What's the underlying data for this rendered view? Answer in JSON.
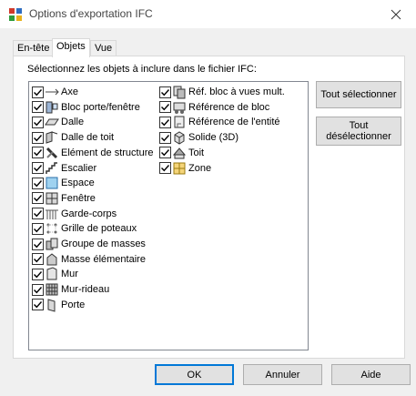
{
  "window": {
    "title": "Options d'exportation IFC",
    "icon": "app-ifc-icon",
    "close_icon": "close-icon"
  },
  "tabs": [
    {
      "label": "En-tête",
      "active": false
    },
    {
      "label": "Objets",
      "active": true
    },
    {
      "label": "Vue",
      "active": false
    }
  ],
  "instruction": "Sélectionnez les objets à inclure dans le fichier IFC:",
  "objects_col1": [
    {
      "label": "Axe",
      "checked": true,
      "icon": "axis-icon"
    },
    {
      "label": "Bloc porte/fenêtre",
      "checked": true,
      "icon": "door-window-block-icon"
    },
    {
      "label": "Dalle",
      "checked": true,
      "icon": "slab-icon"
    },
    {
      "label": "Dalle de toit",
      "checked": true,
      "icon": "roof-slab-icon"
    },
    {
      "label": "Elément de structure",
      "checked": true,
      "icon": "structural-member-icon"
    },
    {
      "label": "Escalier",
      "checked": true,
      "icon": "stair-icon"
    },
    {
      "label": "Espace",
      "checked": true,
      "icon": "space-icon"
    },
    {
      "label": "Fenêtre",
      "checked": true,
      "icon": "window-icon"
    },
    {
      "label": "Garde-corps",
      "checked": true,
      "icon": "railing-icon"
    },
    {
      "label": "Grille de poteaux",
      "checked": true,
      "icon": "column-grid-icon"
    },
    {
      "label": "Groupe de masses",
      "checked": true,
      "icon": "mass-group-icon"
    },
    {
      "label": "Masse élémentaire",
      "checked": true,
      "icon": "mass-element-icon"
    },
    {
      "label": "Mur",
      "checked": true,
      "icon": "wall-icon"
    },
    {
      "label": "Mur-rideau",
      "checked": true,
      "icon": "curtain-wall-icon"
    },
    {
      "label": "Porte",
      "checked": true,
      "icon": "door-icon"
    }
  ],
  "objects_col2": [
    {
      "label": "Réf. bloc à vues mult.",
      "checked": true,
      "icon": "multi-view-block-ref-icon"
    },
    {
      "label": "Référence de bloc",
      "checked": true,
      "icon": "block-reference-icon"
    },
    {
      "label": "Référence de l'entité",
      "checked": true,
      "icon": "entity-reference-icon"
    },
    {
      "label": "Solide (3D)",
      "checked": true,
      "icon": "solid-3d-icon"
    },
    {
      "label": "Toit",
      "checked": true,
      "icon": "roof-icon"
    },
    {
      "label": "Zone",
      "checked": true,
      "icon": "zone-icon"
    }
  ],
  "buttons": {
    "select_all": "Tout sélectionner",
    "deselect_all": "Tout\ndésélectionner",
    "ok": "OK",
    "cancel": "Annuler",
    "help": "Aide"
  },
  "colors": {
    "accent": "#0078d7",
    "list_border": "#828790",
    "button_face": "#e1e1e1"
  }
}
